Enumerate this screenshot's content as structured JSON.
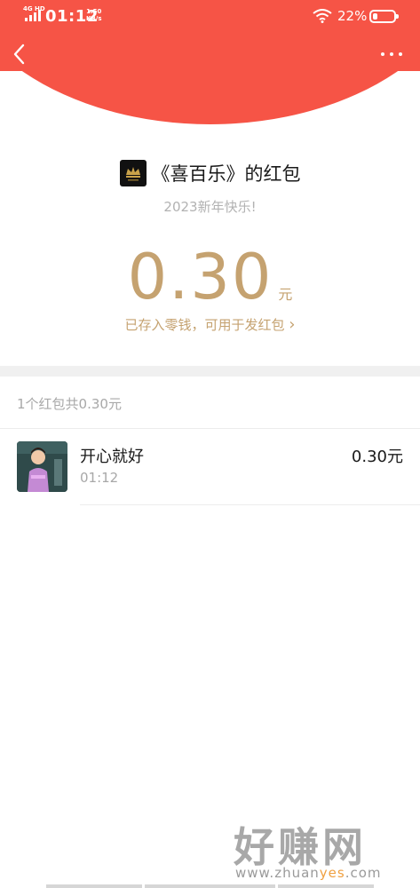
{
  "status_bar": {
    "network": "4G HD",
    "time": "01:12",
    "speed_value": "1.50",
    "speed_unit": "KB/s",
    "battery_percent": "22%",
    "battery_level": 0.22
  },
  "nav": {
    "back_icon": "chevron-left-icon",
    "more_icon": "more-horizontal-icon"
  },
  "red_packet": {
    "sender": "《喜百乐》的红包",
    "greeting": "2023新年快乐!",
    "amount": "0.30",
    "unit": "元",
    "wallet_note": "已存入零钱，可用于发红包",
    "wallet_arrow": "›"
  },
  "summary": "1个红包共0.30元",
  "receivers": [
    {
      "name": "开心就好",
      "time": "01:12",
      "amount": "0.30元"
    }
  ],
  "watermark": {
    "main": "好赚网",
    "url_prefix": "www.zhuan",
    "url_highlight": "yes",
    "url_suffix": ".com"
  },
  "colors": {
    "header_red": "#f65446",
    "gold": "#c5a270",
    "text_dark": "#1a1a1a",
    "text_gray": "#a8a8a8"
  }
}
